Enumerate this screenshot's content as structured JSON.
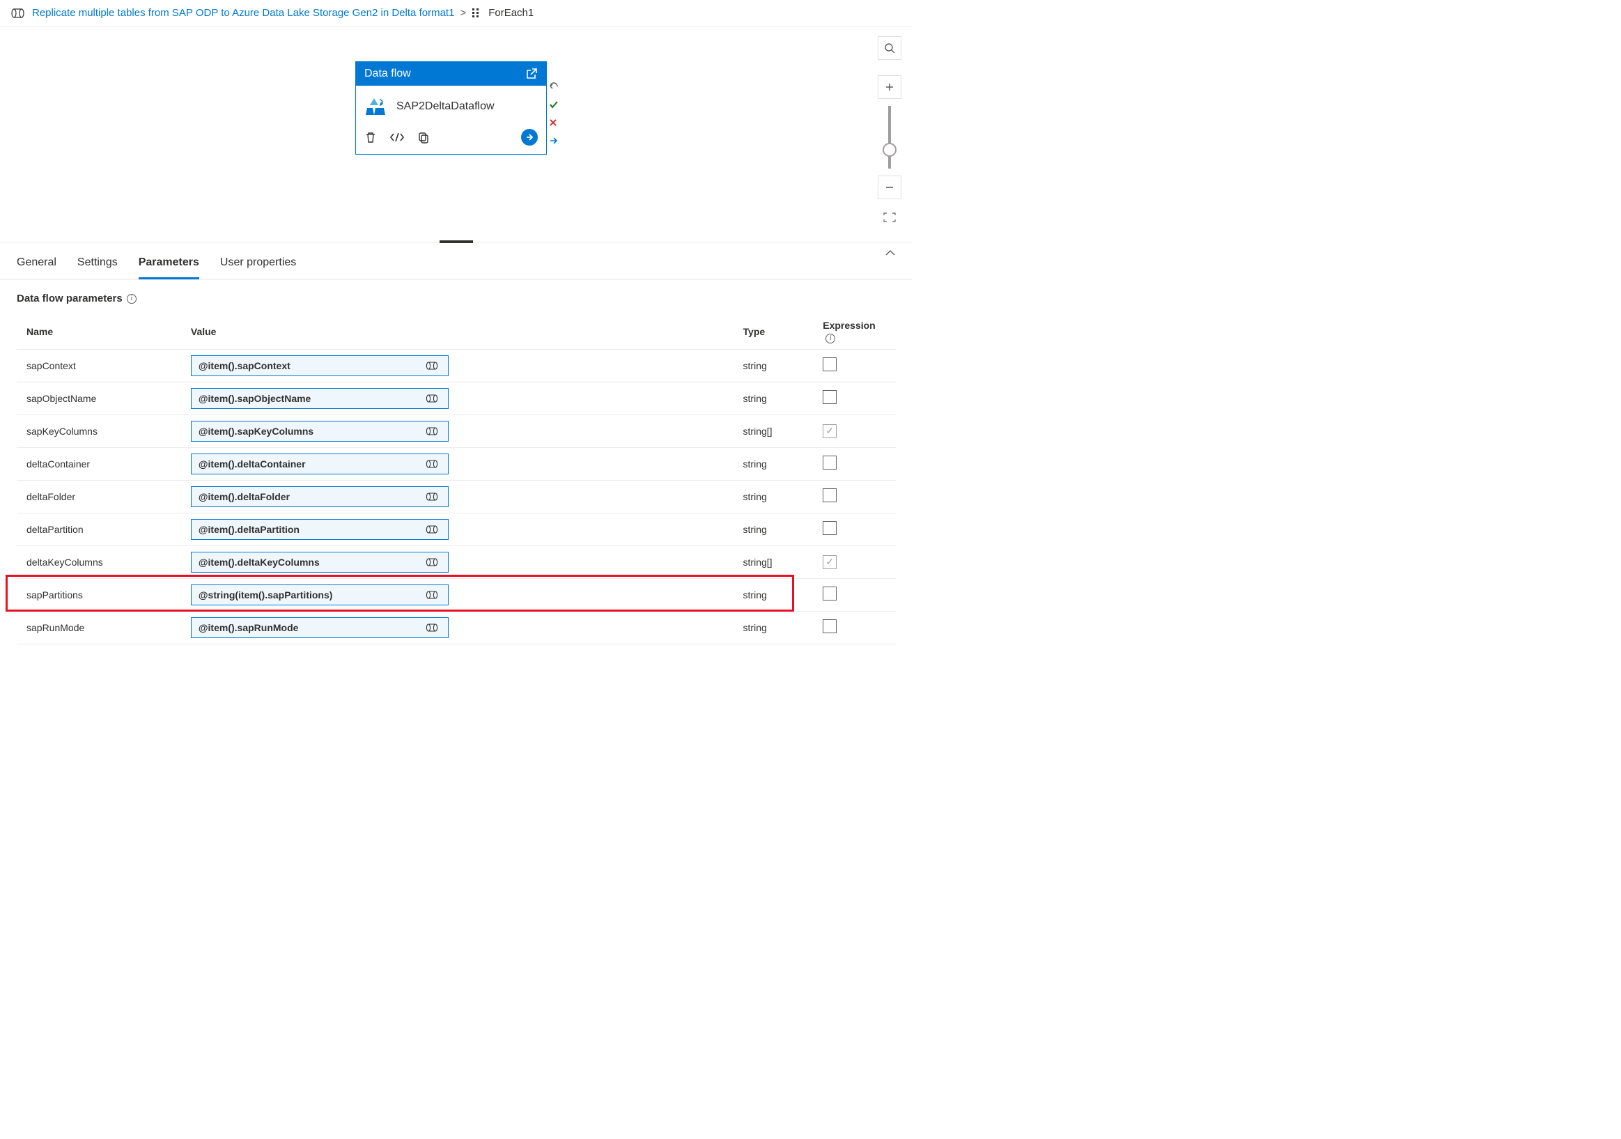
{
  "breadcrumb": {
    "link": "Replicate multiple tables from SAP ODP to Azure Data Lake Storage Gen2 in Delta format1",
    "current": "ForEach1"
  },
  "dataflow_card": {
    "header": "Data flow",
    "name": "SAP2DeltaDataflow"
  },
  "tabs": {
    "t0": "General",
    "t1": "Settings",
    "t2": "Parameters",
    "t3": "User properties"
  },
  "section_title": "Data flow parameters",
  "columns": {
    "name": "Name",
    "value": "Value",
    "type": "Type",
    "expr": "Expression"
  },
  "rows": [
    {
      "name": "sapContext",
      "value": "@item().sapContext",
      "type": "string",
      "checked": false
    },
    {
      "name": "sapObjectName",
      "value": "@item().sapObjectName",
      "type": "string",
      "checked": false
    },
    {
      "name": "sapKeyColumns",
      "value": "@item().sapKeyColumns",
      "type": "string[]",
      "checked": true
    },
    {
      "name": "deltaContainer",
      "value": "@item().deltaContainer",
      "type": "string",
      "checked": false
    },
    {
      "name": "deltaFolder",
      "value": "@item().deltaFolder",
      "type": "string",
      "checked": false
    },
    {
      "name": "deltaPartition",
      "value": "@item().deltaPartition",
      "type": "string",
      "checked": false
    },
    {
      "name": "deltaKeyColumns",
      "value": "@item().deltaKeyColumns",
      "type": "string[]",
      "checked": true
    },
    {
      "name": "sapPartitions",
      "value": "@string(item().sapPartitions)",
      "type": "string",
      "checked": false
    },
    {
      "name": "sapRunMode",
      "value": "@item().sapRunMode",
      "type": "string",
      "checked": false
    }
  ]
}
